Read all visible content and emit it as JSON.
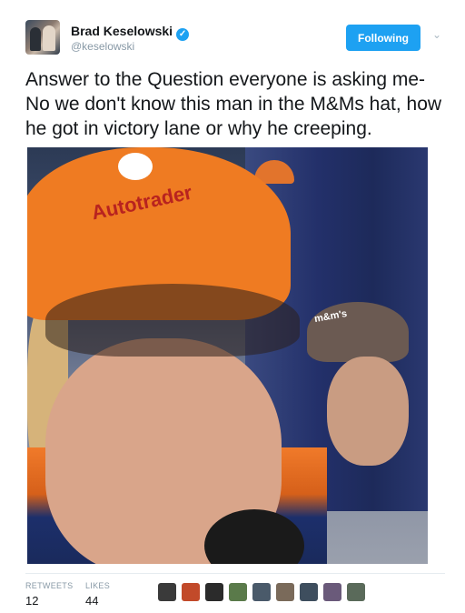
{
  "tweet": {
    "author_name": "Brad Keselowski",
    "author_handle": "@keselowski",
    "follow_label": "Following",
    "text": "Answer to the Question everyone is asking me- No we don't know this man in the M&Ms hat, how he got in victory lane or why he creeping."
  },
  "stats": {
    "retweets_label": "RETWEETS",
    "retweets_value": "12",
    "likes_label": "LIKES",
    "likes_value": "44"
  },
  "likers": [
    {
      "color": "#3a3a3a"
    },
    {
      "color": "#c24a2a"
    },
    {
      "color": "#2b2b2b"
    },
    {
      "color": "#5a7a4a"
    },
    {
      "color": "#4a5a6a"
    },
    {
      "color": "#7a6a5a"
    },
    {
      "color": "#3e4e5e"
    },
    {
      "color": "#6a5a7a"
    },
    {
      "color": "#5a6a5a"
    }
  ],
  "photo_text": {
    "cap_brand": "Autotrader",
    "hat_brand": "m&m's"
  },
  "colors": {
    "accent": "#1da1f2",
    "text": "#14171a",
    "muted": "#8899a6"
  }
}
